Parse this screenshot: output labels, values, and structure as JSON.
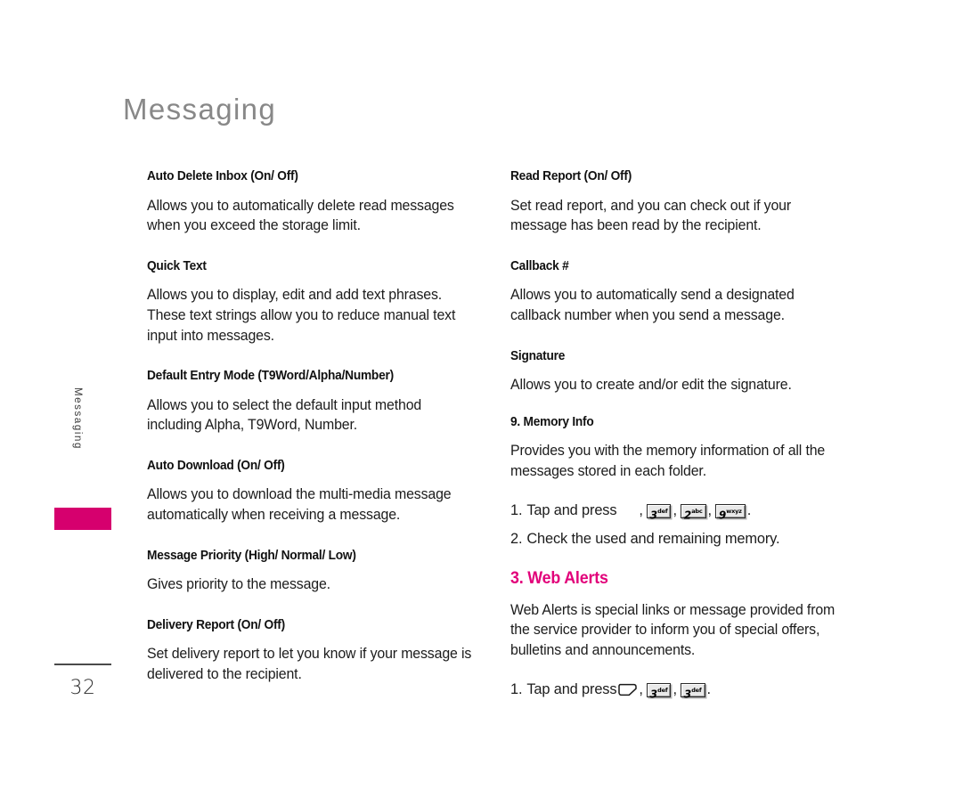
{
  "page": {
    "title": "Messaging",
    "number": "32",
    "side_tab_label": "Messaging",
    "accent_color": "#d6006e",
    "heading_accent_color": "#e2007a",
    "title_color": "#888888"
  },
  "left_column": {
    "sections": [
      {
        "heading": "Auto Delete Inbox (On/ Off)",
        "body": "Allows you to automatically delete read messages when you exceed the storage limit."
      },
      {
        "heading": "Quick Text",
        "body": "Allows you to display, edit and add text phrases. These text strings allow you to reduce manual text input into messages."
      },
      {
        "heading": "Default Entry Mode (T9Word/Alpha/Number)",
        "body": "Allows you to select the default input method including Alpha, T9Word, Number."
      },
      {
        "heading": "Auto Download (On/ Off)",
        "body": "Allows you to download the multi-media message automatically when receiving a message."
      },
      {
        "heading": "Message Priority (High/ Normal/ Low)",
        "body": "Gives priority to the message."
      },
      {
        "heading": "Delivery Report (On/ Off)",
        "body": "Set delivery report to let you know if your message is delivered to the recipient."
      }
    ]
  },
  "right_column": {
    "sections": [
      {
        "heading": "Read Report (On/ Off)",
        "body": "Set read report, and you can check out if your message has been read by the recipient."
      },
      {
        "heading": "Callback #",
        "body": "Allows you to automatically send a designated callback number when you send a message."
      },
      {
        "heading": "Signature",
        "body": "Allows you to create and/or edit the signature."
      }
    ],
    "memory_info": {
      "heading": "9. Memory Info",
      "body": "Provides you with the memory information of all the messages stored in each folder.",
      "step1": {
        "number": "1.",
        "text": "Tap and press",
        "keys": [
          {
            "icon": "blank-key-icon",
            "digit": "",
            "sub": ""
          },
          {
            "icon": "key-3-def-icon",
            "digit": "3",
            "sub": "def"
          },
          {
            "icon": "key-2-abc-icon",
            "digit": "2",
            "sub": "abc"
          },
          {
            "icon": "key-9-wxyz-icon",
            "digit": "9",
            "sub": "wxyz"
          }
        ],
        "separator": ",",
        "terminator": "."
      },
      "step2": {
        "number": "2.",
        "text": "Check the used and remaining memory."
      }
    },
    "web_alerts": {
      "heading": "3. Web Alerts",
      "body": "Web Alerts is special links or message provided from the service provider to inform you of special offers, bulletins and announcements.",
      "step1": {
        "number": "1.",
        "text": "Tap and press",
        "keys": [
          {
            "icon": "softkey-menu-icon",
            "digit": "",
            "sub": ""
          },
          {
            "icon": "key-3-def-icon",
            "digit": "3",
            "sub": "def"
          },
          {
            "icon": "key-3-def-icon",
            "digit": "3",
            "sub": "def"
          }
        ],
        "separator": ",",
        "terminator": "."
      }
    }
  }
}
